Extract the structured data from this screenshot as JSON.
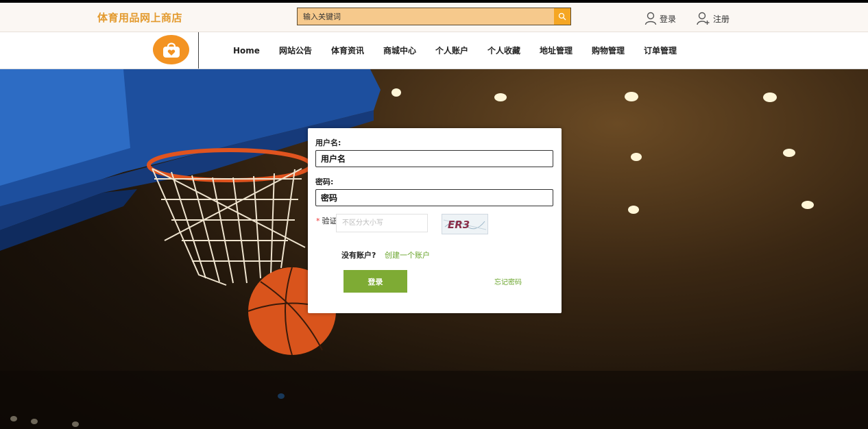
{
  "header": {
    "site_title": "体育用品网上商店",
    "search": {
      "placeholder": "输入关键词",
      "button_icon": "search-icon"
    },
    "login_label": "登录",
    "register_label": "注册"
  },
  "nav": {
    "logo_icon": "shopping-bag-heart-icon",
    "items": [
      {
        "label": "Home"
      },
      {
        "label": "网站公告"
      },
      {
        "label": "体育资讯"
      },
      {
        "label": "商城中心"
      },
      {
        "label": "个人账户"
      },
      {
        "label": "个人收藏"
      },
      {
        "label": "地址管理"
      },
      {
        "label": "购物管理"
      },
      {
        "label": "订单管理"
      }
    ]
  },
  "hero": {
    "background": "basketball-hoop-arena-photo"
  },
  "login_form": {
    "username_label": "用户名:",
    "username_value": "用户名",
    "password_label": "密码:",
    "password_value": "密码",
    "captcha_label": "验证",
    "captcha_placeholder": "不区分大小写",
    "captcha_text": "ER3",
    "no_account_text": "没有账户?",
    "create_account_link": "创建一个账户",
    "login_button": "登录",
    "forgot_password_link": "忘记密码"
  },
  "colors": {
    "brand_orange": "#f39322",
    "title_orange": "#e39a2e",
    "search_bg": "#f6c98c",
    "accent_green": "#7eab34",
    "link_green": "#6aa52c"
  }
}
